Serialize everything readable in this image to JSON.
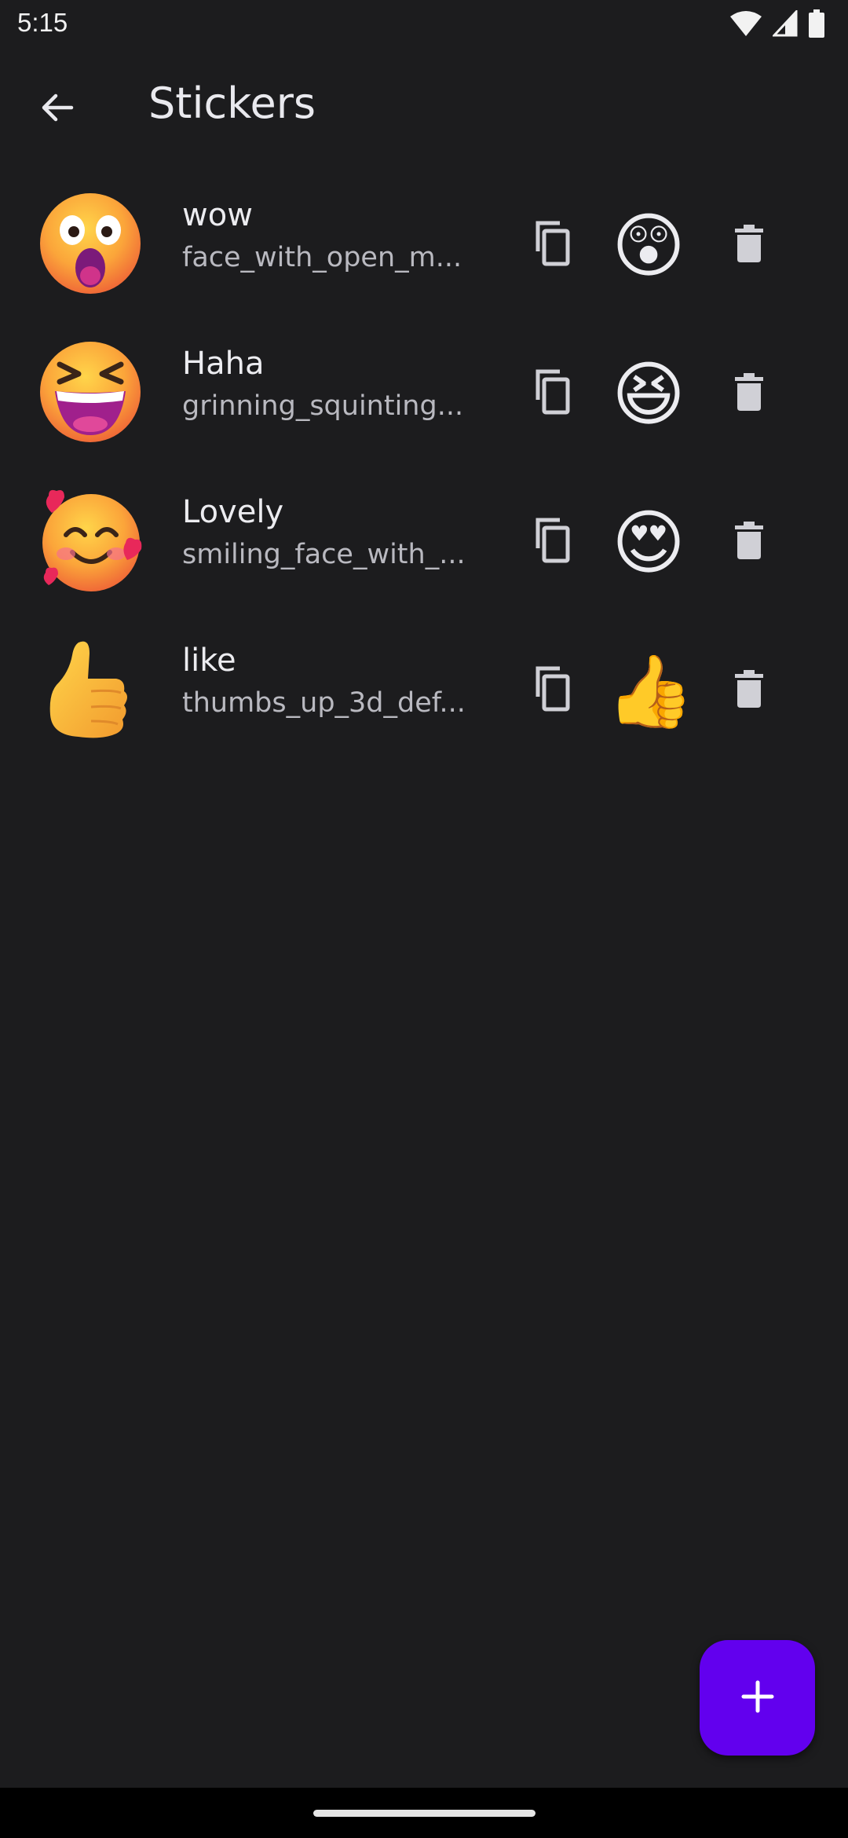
{
  "status_bar": {
    "time": "5:15",
    "icons": [
      "wifi-icon",
      "cell-signal-icon",
      "battery-icon"
    ]
  },
  "app_bar": {
    "title": "Stickers",
    "back_icon": "arrow-back-icon"
  },
  "stickers": [
    {
      "name": "wow",
      "file": "face_with_open_m...",
      "emoji": "😲",
      "thumb": "face-with-open-mouth-3d"
    },
    {
      "name": "Haha",
      "file": "grinning_squinting...",
      "emoji": "😆",
      "thumb": "grinning-squinting-face-3d"
    },
    {
      "name": "Lovely",
      "file": "smiling_face_with_...",
      "emoji": "😍",
      "thumb": "smiling-face-with-hearts-3d"
    },
    {
      "name": "like",
      "file": "thumbs_up_3d_def...",
      "emoji": "👍",
      "thumb": "thumbs-up-3d"
    }
  ],
  "row_icons": {
    "copy": "copy-icon",
    "delete": "delete-icon"
  },
  "fab": {
    "icon": "plus-icon",
    "color": "#6200ee"
  },
  "colors": {
    "background": "#1c1c1e",
    "accent": "#6200ee"
  }
}
